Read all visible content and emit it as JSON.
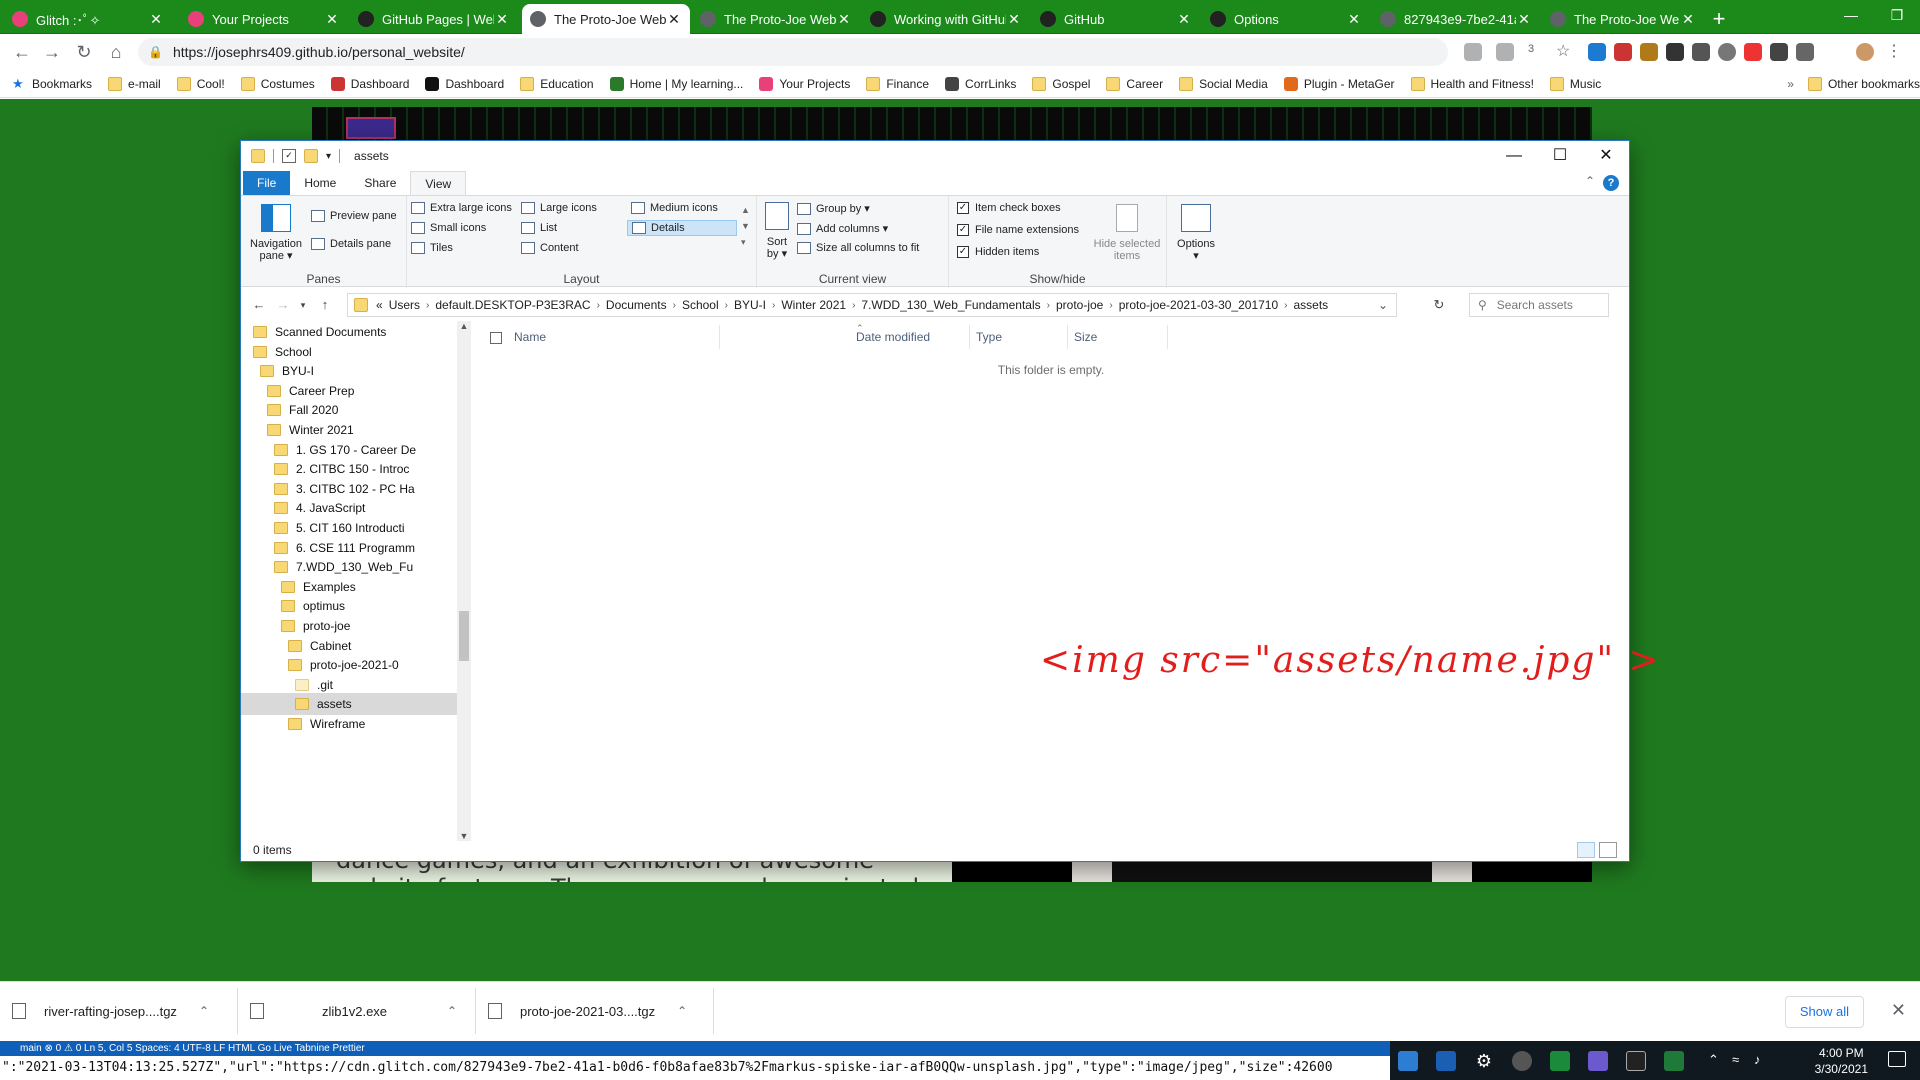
{
  "browser": {
    "tabs": [
      {
        "title": "Glitch :･ﾟ✧",
        "color": "#e8407a"
      },
      {
        "title": "Your Projects",
        "color": "#e8407a"
      },
      {
        "title": "GitHub Pages | Websi...",
        "color": "#222222"
      },
      {
        "title": "The Proto-Joe Websi...",
        "color": "#5f6368",
        "active": true
      },
      {
        "title": "The Proto-Joe Websi...",
        "color": "#5f6368"
      },
      {
        "title": "Working with GitHub...",
        "color": "#222222"
      },
      {
        "title": "GitHub",
        "color": "#222222"
      },
      {
        "title": "Options",
        "color": "#222222"
      },
      {
        "title": "827943e9-7be2-41a...",
        "color": "#5f6368"
      },
      {
        "title": "The Proto-Joe Websi...",
        "color": "#5f6368"
      }
    ],
    "url": "https://josephrs409.github.io/personal_website/",
    "extension_badge": "3",
    "bookmarks": [
      {
        "label": "Bookmarks",
        "icon": "star-icon"
      },
      {
        "label": "e-mail",
        "icon": "folder-icon"
      },
      {
        "label": "Cool!",
        "icon": "folder-icon"
      },
      {
        "label": "Costumes",
        "icon": "folder-icon"
      },
      {
        "label": "Dashboard",
        "icon": "dashboard-icon"
      },
      {
        "label": "Dashboard",
        "icon": "byu-icon"
      },
      {
        "label": "Education",
        "icon": "folder-icon"
      },
      {
        "label": "Home | My learning...",
        "icon": "w-icon"
      },
      {
        "label": "Your Projects",
        "icon": "glitch-icon"
      },
      {
        "label": "Finance",
        "icon": "folder-icon"
      },
      {
        "label": "CorrLinks",
        "icon": "corrlinks-icon"
      },
      {
        "label": "Gospel",
        "icon": "folder-icon"
      },
      {
        "label": "Career",
        "icon": "folder-icon"
      },
      {
        "label": "Social Media",
        "icon": "folder-icon"
      },
      {
        "label": "Plugin - MetaGer",
        "icon": "metager-icon"
      },
      {
        "label": "Health and Fitness!",
        "icon": "folder-icon"
      },
      {
        "label": "Music",
        "icon": "folder-icon"
      }
    ],
    "other_bookmarks": "Other bookmarks",
    "overflow_chevron": "»"
  },
  "webpage": {
    "paragraph": "prototype. Think of this as a model for a building. For these three pages I will be highlighting my works, passion for machine-dance games, and an exhibition of awesome website features. Those pages can be navigated via the the top navigation bar. See what"
  },
  "explorer": {
    "title": "assets",
    "ribbon_tabs": [
      "File",
      "Home",
      "Share",
      "View"
    ],
    "active_tab": "View",
    "panes_group": {
      "label": "Panes",
      "navigation_pane": "Navigation pane",
      "preview_pane": "Preview pane",
      "details_pane": "Details pane"
    },
    "layout_group": {
      "label": "Layout",
      "items": [
        "Extra large icons",
        "Large icons",
        "Medium icons",
        "Small icons",
        "List",
        "Details",
        "Tiles",
        "Content"
      ],
      "selected": "Details"
    },
    "current_view_group": {
      "label": "Current view",
      "sort_by": "Sort by",
      "group_by": "Group by",
      "add_columns": "Add columns",
      "size_all": "Size all columns to fit"
    },
    "show_hide_group": {
      "label": "Show/hide",
      "item_check_boxes": "Item check boxes",
      "file_name_extensions": "File name extensions",
      "hidden_items": "Hidden items",
      "hide_selected": "Hide selected items"
    },
    "options": "Options",
    "breadcrumb": [
      "Users",
      "default.DESKTOP-P3E3RAC",
      "Documents",
      "School",
      "BYU-I",
      "Winter 2021",
      "7.WDD_130_Web_Fundamentals",
      "proto-joe",
      "proto-joe-2021-03-30_201710",
      "assets"
    ],
    "breadcrumb_prefix": "«",
    "search_placeholder": "Search assets",
    "tree": [
      {
        "label": "Scanned Documents",
        "indent": 0
      },
      {
        "label": "School",
        "indent": 0
      },
      {
        "label": "BYU-I",
        "indent": 1
      },
      {
        "label": "Career Prep",
        "indent": 2
      },
      {
        "label": "Fall 2020",
        "indent": 2
      },
      {
        "label": "Winter 2021",
        "indent": 2
      },
      {
        "label": "1. GS 170 - Career De",
        "indent": 3
      },
      {
        "label": "2. CITBC 150 - Introc",
        "indent": 3
      },
      {
        "label": "3. CITBC 102 - PC Ha",
        "indent": 3
      },
      {
        "label": "4. JavaScript",
        "indent": 3
      },
      {
        "label": "5. CIT 160 Introducti",
        "indent": 3
      },
      {
        "label": "6. CSE 111 Programm",
        "indent": 3
      },
      {
        "label": "7.WDD_130_Web_Fu",
        "indent": 3
      },
      {
        "label": "Examples",
        "indent": 4
      },
      {
        "label": "optimus",
        "indent": 4
      },
      {
        "label": "proto-joe",
        "indent": 4
      },
      {
        "label": "Cabinet",
        "indent": 5
      },
      {
        "label": "proto-joe-2021-0",
        "indent": 5
      },
      {
        "label": ".git",
        "indent": 6,
        "git": true
      },
      {
        "label": "assets",
        "indent": 6,
        "selected": true
      },
      {
        "label": "Wireframe",
        "indent": 5
      }
    ],
    "columns": [
      "Name",
      "Date modified",
      "Type",
      "Size"
    ],
    "empty_message": "This folder is empty.",
    "status": "0 items"
  },
  "annotation": {
    "text": "<img src=\"assets/name.jpg\" >",
    "color": "#e31c1c"
  },
  "downloads": [
    {
      "name": "river-rafting-josep....tgz"
    },
    {
      "name": "zlib1v2.exe"
    },
    {
      "name": "proto-joe-2021-03....tgz"
    }
  ],
  "show_all": "Show all",
  "vscode_status": "main   ⊗ 0 ⚠ 0   Ln 5, Col 5   Spaces: 4   UTF-8   LF   HTML   Go Live   Tabnine   Prettier",
  "json_line": "\":\"2021-03-13T04:13:25.527Z\",\"url\":\"https://cdn.glitch.com/827943e9-7be2-41a1-b0d6-f0b8afae83b7%2Fmarkus-spiske-iar-afB0QQw-unsplash.jpg\",\"type\":\"image/jpeg\",\"size\":42600",
  "taskbar": {
    "time": "4:00 PM",
    "date": "3/30/2021"
  },
  "colors": {
    "chrome_frame": "#1b8a1b",
    "page_bg": "#1f7a1f",
    "explorer_accent": "#1979ca"
  }
}
